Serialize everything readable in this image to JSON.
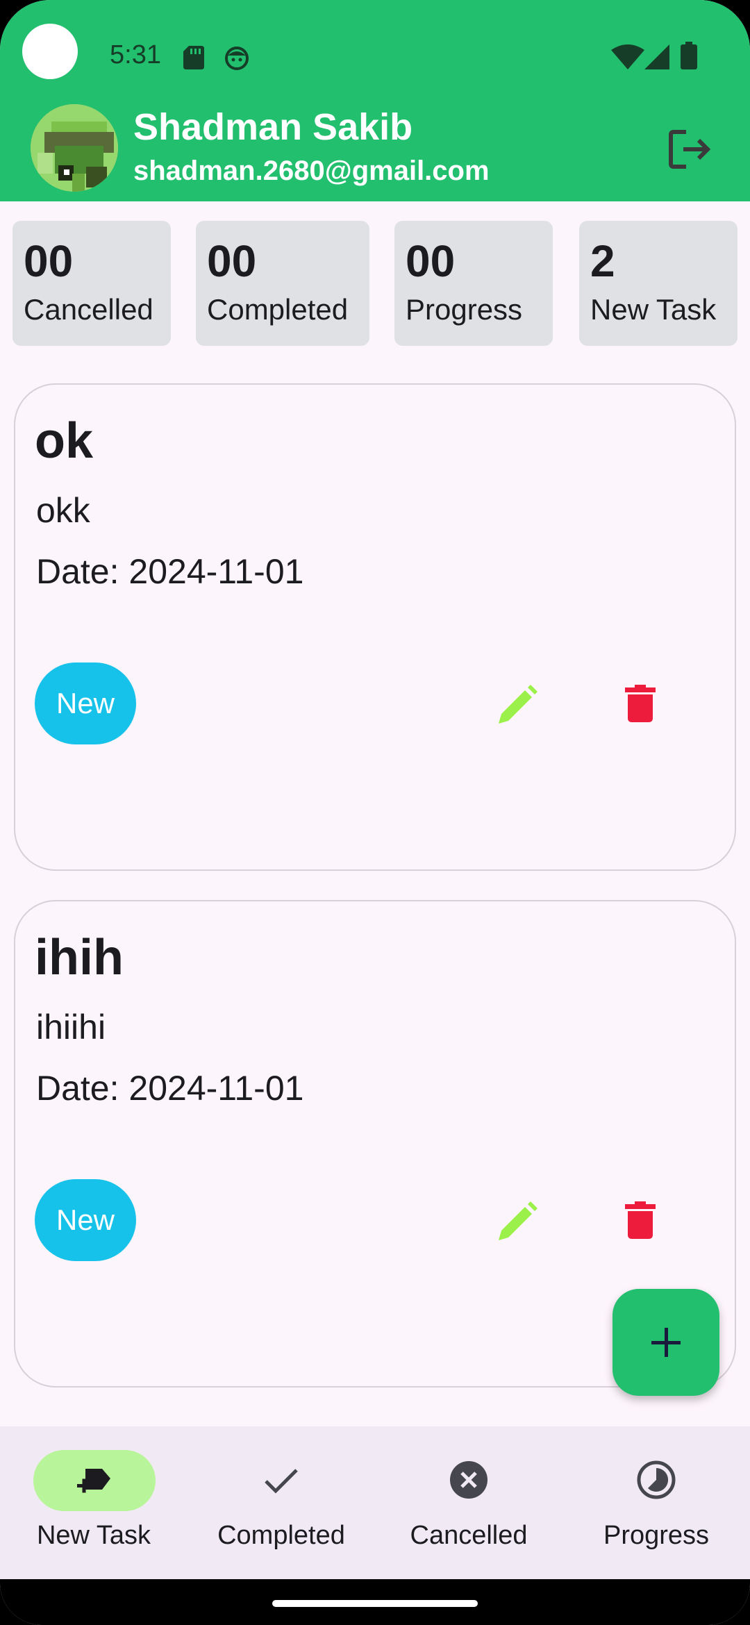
{
  "status_bar": {
    "time": "5:31"
  },
  "profile": {
    "name": "Shadman Sakib",
    "email": "shadman.2680@gmail.com"
  },
  "summary": [
    {
      "count": "00",
      "label": "Cancelled"
    },
    {
      "count": "00",
      "label": "Completed"
    },
    {
      "count": "00",
      "label": "Progress"
    },
    {
      "count": "2",
      "label": "New Task"
    }
  ],
  "tasks": [
    {
      "title": "ok",
      "description": "okk",
      "date": "Date: 2024-11-01",
      "status": "New"
    },
    {
      "title": "ihih",
      "description": "ihiihi",
      "date": "Date: 2024-11-01",
      "status": "New"
    }
  ],
  "bottom_nav": [
    {
      "label": "New Task",
      "icon": "new-task-icon",
      "active": true
    },
    {
      "label": "Completed",
      "icon": "check-icon",
      "active": false
    },
    {
      "label": "Cancelled",
      "icon": "cancel-circle-icon",
      "active": false
    },
    {
      "label": "Progress",
      "icon": "progress-icon",
      "active": false
    }
  ],
  "colors": {
    "header": "#22bf6f",
    "chip": "#17c2ea",
    "edit": "#9cf04a",
    "delete": "#ee1c3c",
    "nav_active": "#b8f59a"
  }
}
